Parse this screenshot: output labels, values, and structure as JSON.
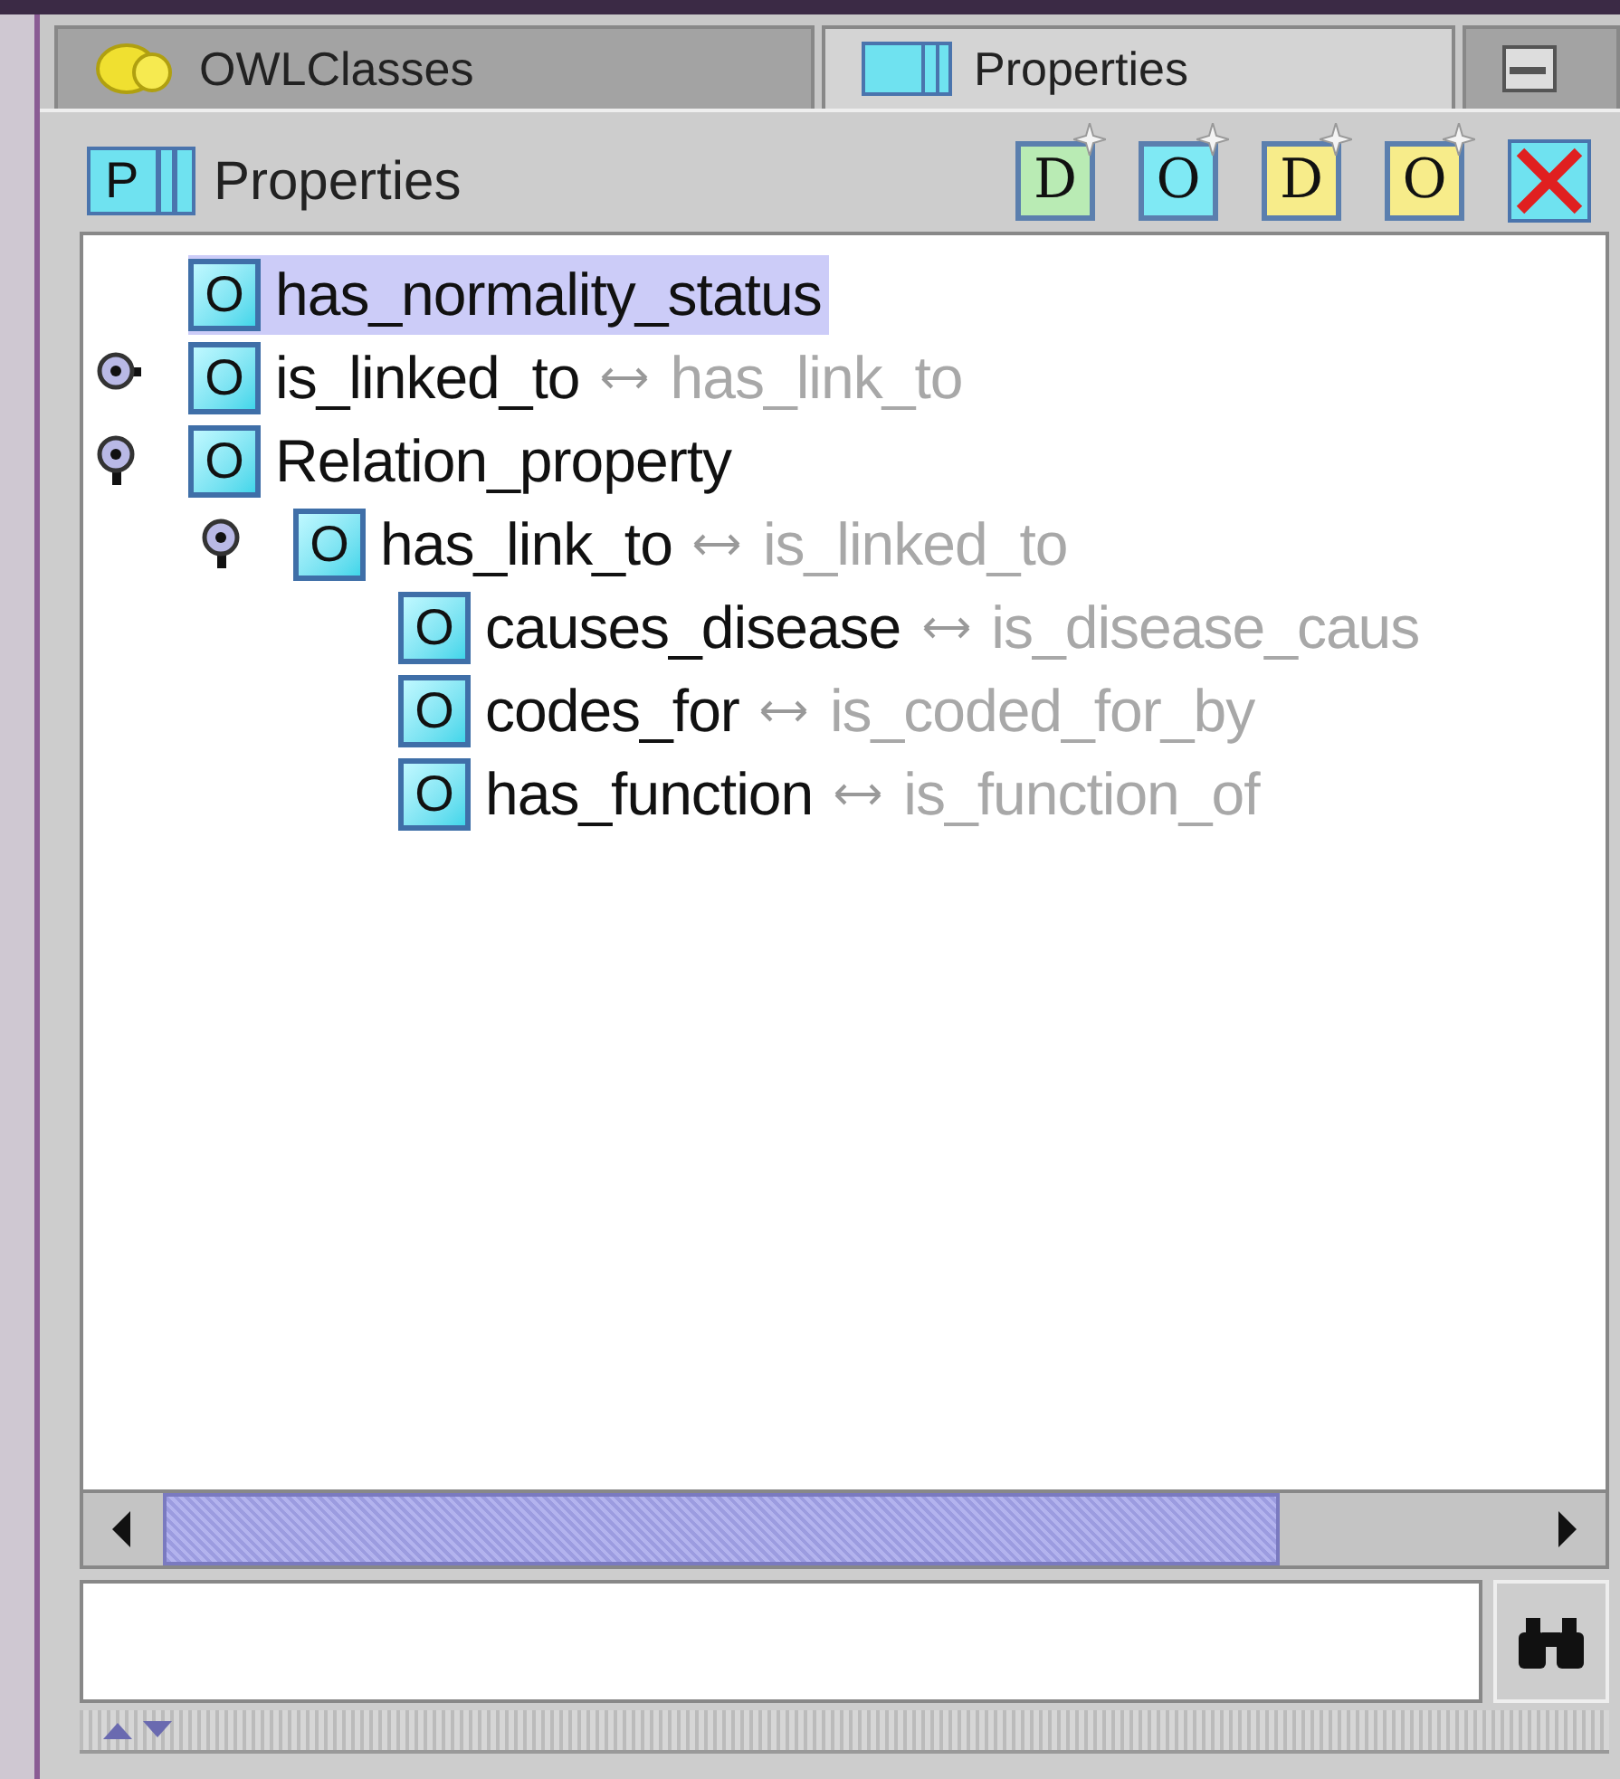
{
  "tabs": [
    {
      "label": "OWLClasses",
      "kind": "classes",
      "selected": false
    },
    {
      "label": "Properties",
      "kind": "properties",
      "selected": true
    },
    {
      "kind": "other",
      "selected": false
    }
  ],
  "header": {
    "icon_letter": "P",
    "title": "Properties"
  },
  "toolbar": [
    {
      "kind": "create",
      "letter": "D",
      "color": "#b9ebb4"
    },
    {
      "kind": "create",
      "letter": "O",
      "color": "#7fe9f4"
    },
    {
      "kind": "create",
      "letter": "D",
      "color": "#f7ec8a"
    },
    {
      "kind": "create",
      "letter": "O",
      "color": "#f7ec8a"
    },
    {
      "kind": "delete"
    }
  ],
  "tree": [
    {
      "icon_letter": "O",
      "label": "has_normality_status",
      "selected": true
    },
    {
      "icon_letter": "O",
      "label": "is_linked_to",
      "inverse": "has_link_to",
      "selected": false,
      "expanded": false
    },
    {
      "icon_letter": "O",
      "label": "Relation_property",
      "selected": false,
      "expanded": true,
      "children": [
        {
          "icon_letter": "O",
          "label": "has_link_to",
          "inverse": "is_linked_to",
          "selected": false,
          "expanded": true,
          "children": [
            {
              "icon_letter": "O",
              "label": "causes_disease",
              "inverse": "is_disease_caus",
              "selected": false
            },
            {
              "icon_letter": "O",
              "label": "codes_for",
              "inverse": "is_coded_for_by",
              "selected": false
            },
            {
              "icon_letter": "O",
              "label": "has_function",
              "inverse": "is_function_of",
              "selected": false
            }
          ]
        }
      ]
    }
  ]
}
